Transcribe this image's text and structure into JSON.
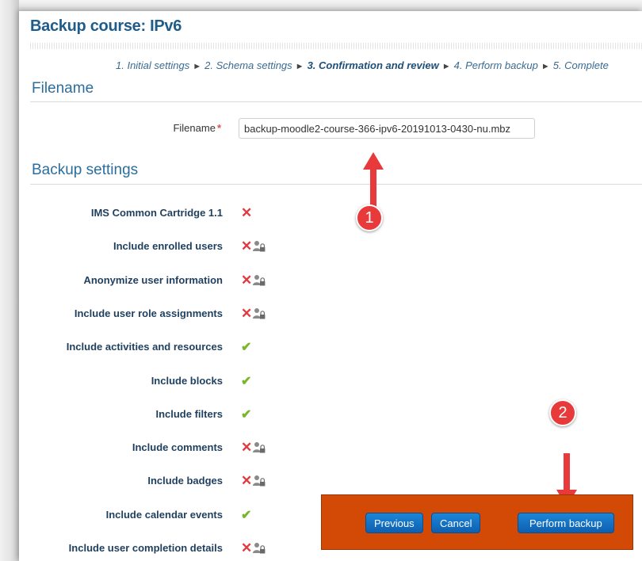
{
  "page": {
    "title": "Backup course: IPv6"
  },
  "progress": {
    "steps": [
      "1. Initial settings",
      "2. Schema settings",
      "3. Confirmation and review",
      "4. Perform backup",
      "5. Complete"
    ],
    "separator": "►",
    "current_step": 3
  },
  "filename_section": {
    "heading": "Filename",
    "label": "Filename",
    "required_marker": "*",
    "value": "backup-moodle2-course-366-ipv6-20191013-0430-nu.mbz"
  },
  "backup_settings": {
    "heading": "Backup settings",
    "items": [
      {
        "label": "IMS Common Cartridge 1.1",
        "status": "off",
        "locked": false
      },
      {
        "label": "Include enrolled users",
        "status": "off",
        "locked": true
      },
      {
        "label": "Anonymize user information",
        "status": "off",
        "locked": true
      },
      {
        "label": "Include user role assignments",
        "status": "off",
        "locked": true
      },
      {
        "label": "Include activities and resources",
        "status": "on",
        "locked": false
      },
      {
        "label": "Include blocks",
        "status": "on",
        "locked": false
      },
      {
        "label": "Include filters",
        "status": "on",
        "locked": false
      },
      {
        "label": "Include comments",
        "status": "off",
        "locked": true
      },
      {
        "label": "Include badges",
        "status": "off",
        "locked": true
      },
      {
        "label": "Include calendar events",
        "status": "on",
        "locked": false
      },
      {
        "label": "Include user completion details",
        "status": "off",
        "locked": true
      }
    ]
  },
  "annotations": {
    "marker_1": "1",
    "marker_2": "2",
    "color": "#e8393b"
  },
  "actions": {
    "previous": "Previous",
    "cancel": "Cancel",
    "perform_backup": "Perform backup",
    "highlight_color": "#d24a05"
  },
  "icons": {
    "off": "cross-icon",
    "on": "check-icon",
    "locked": "lock-icon"
  }
}
